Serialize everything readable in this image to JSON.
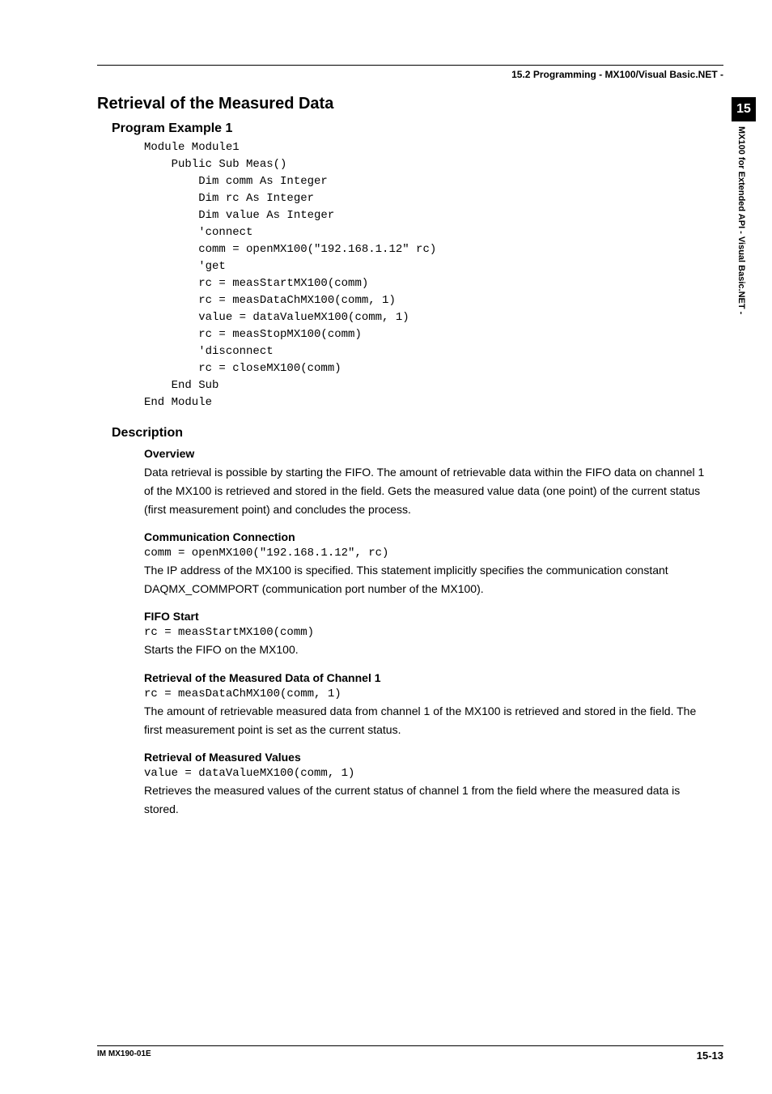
{
  "header": {
    "breadcrumb": "15.2  Programming - MX100/Visual Basic.NET -"
  },
  "sidetab": {
    "chapter": "15",
    "label": "MX100 for Extended API - Visual Basic.NET -"
  },
  "section": {
    "title": "Retrieval of the Measured Data",
    "example_title": "Program Example 1",
    "code": "Module Module1\n    Public Sub Meas()\n        Dim comm As Integer\n        Dim rc As Integer\n        Dim value As Integer\n        'connect\n        comm = openMX100(\"192.168.1.12\" rc)\n        'get\n        rc = measStartMX100(comm)\n        rc = measDataChMX100(comm, 1)\n        value = dataValueMX100(comm, 1)\n        rc = measStopMX100(comm)\n        'disconnect\n        rc = closeMX100(comm)\n    End Sub\nEnd Module"
  },
  "description": {
    "title": "Description",
    "overview": {
      "heading": "Overview",
      "text": "Data retrieval is possible by starting the FIFO. The amount of retrievable data within the FIFO data on channel 1 of the MX100 is retrieved and stored in the field. Gets the measured value data (one point) of the current status (first measurement point) and concludes the process."
    },
    "comm": {
      "heading": "Communication Connection",
      "code": "comm = openMX100(\"192.168.1.12\", rc)",
      "text": "The IP address of the MX100 is specified. This statement implicitly specifies the communication constant DAQMX_COMMPORT (communication port number of the MX100)."
    },
    "fifo": {
      "heading": "FIFO Start",
      "code": "rc = measStartMX100(comm)",
      "text": "Starts the FIFO on the MX100."
    },
    "retrieval": {
      "heading": "Retrieval of the Measured Data of Channel 1",
      "code": "rc = measDataChMX100(comm, 1)",
      "text": "The amount of retrievable measured data from channel 1 of the MX100 is retrieved and stored in the field. The first measurement point is set as the current status."
    },
    "values": {
      "heading": "Retrieval of Measured Values",
      "code": "value = dataValueMX100(comm, 1)",
      "text": "Retrieves the measured values of the current status of channel 1 from the field where the measured data is stored."
    }
  },
  "footer": {
    "left": "IM MX190-01E",
    "right": "15-13"
  }
}
